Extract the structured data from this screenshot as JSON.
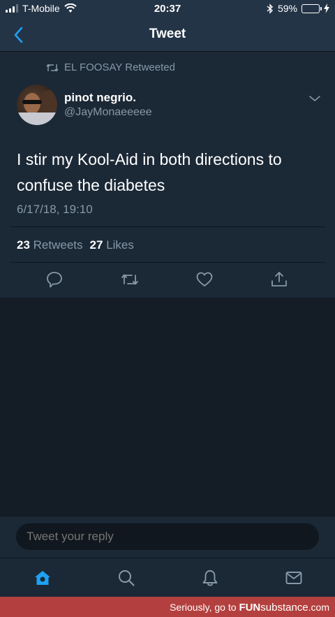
{
  "status_bar": {
    "carrier": "T-Mobile",
    "time": "20:37",
    "battery": "59%",
    "battery_fraction": 0.59
  },
  "nav": {
    "title": "Tweet"
  },
  "tweet": {
    "retweeted_by": "EL FOOSAY Retweeted",
    "display_name": "pinot negrio.",
    "handle": "@JayMonaeeeee",
    "text": "I stir my Kool-Aid in both directions to confuse the diabetes",
    "timestamp": "6/17/18, 19:10",
    "retweets_count": "23",
    "retweets_label": "Retweets",
    "likes_count": "27",
    "likes_label": "Likes"
  },
  "compose": {
    "placeholder": "Tweet your reply"
  },
  "promo": {
    "prefix": "Seriously, go to",
    "brand_bold": "FUN",
    "brand_rest": "substance",
    "suffix": ".com"
  },
  "colors": {
    "accent": "#1da1f2",
    "muted": "#8899a6",
    "background": "#141d26",
    "card": "#1b2836",
    "header": "#243447"
  }
}
